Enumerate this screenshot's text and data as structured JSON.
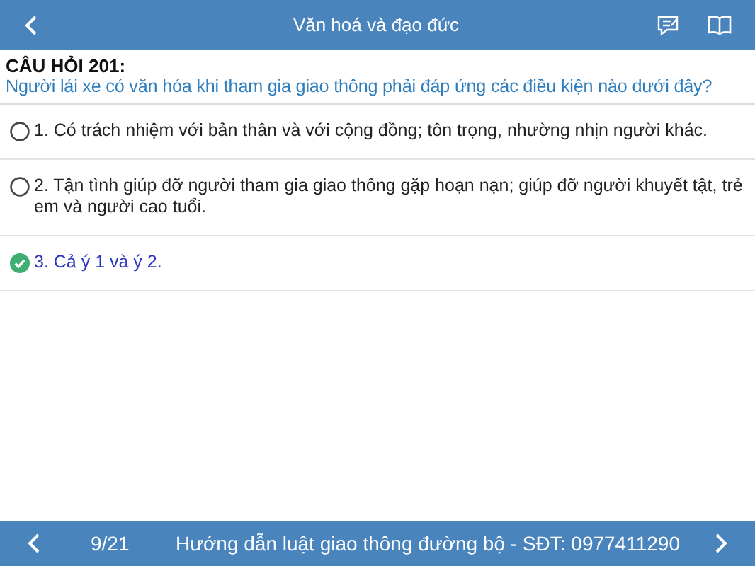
{
  "header": {
    "title": "Văn hoá và đạo đức"
  },
  "question": {
    "number": "CÂU HỎI 201:",
    "text": "Người lái xe có văn hóa khi tham gia giao thông phải đáp ứng các điều kiện nào dưới đây?"
  },
  "answers": [
    {
      "text": "1. Có trách nhiệm với bản thân và với cộng đồng; tôn trọng, nhường nhịn người khác.",
      "selected": false
    },
    {
      "text": "2. Tận tình giúp đỡ người tham gia giao thông gặp hoạn nạn; giúp đỡ người khuyết tật, trẻ em và người cao tuổi.",
      "selected": false
    },
    {
      "text": "3. Cả ý 1 và ý 2.",
      "selected": true
    }
  ],
  "footer": {
    "page": "9/21",
    "caption": "Hướng dẫn luật giao thông đường bộ - SĐT: 0977411290"
  }
}
